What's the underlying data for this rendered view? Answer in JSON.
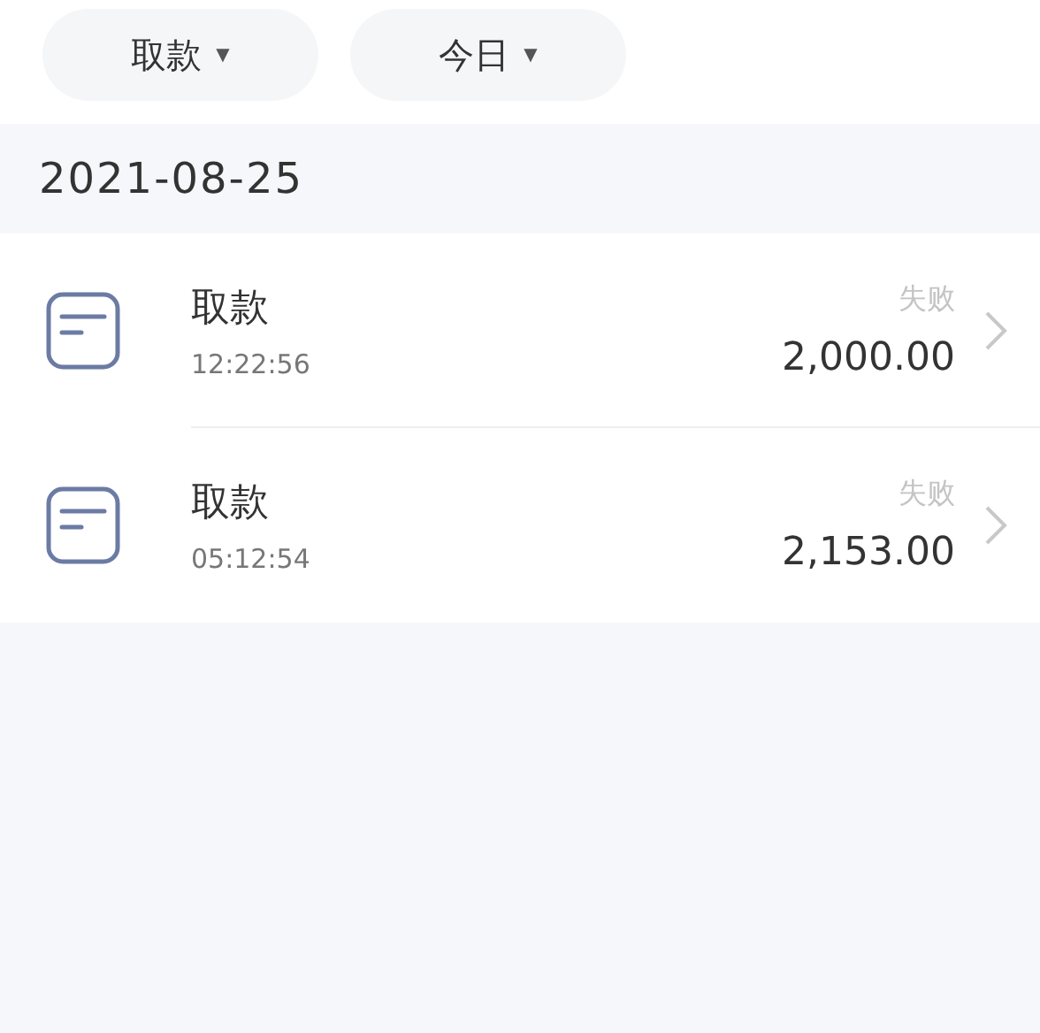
{
  "filters": [
    {
      "label": "取款",
      "caret": "▼"
    },
    {
      "label": "今日",
      "caret": "▼"
    }
  ],
  "date_header": "2021-08-25",
  "transactions": [
    {
      "title": "取款",
      "time": "12:22:56",
      "status": "失败",
      "amount": "2,000.00"
    },
    {
      "title": "取款",
      "time": "05:12:54",
      "status": "失败",
      "amount": "2,153.00"
    }
  ]
}
